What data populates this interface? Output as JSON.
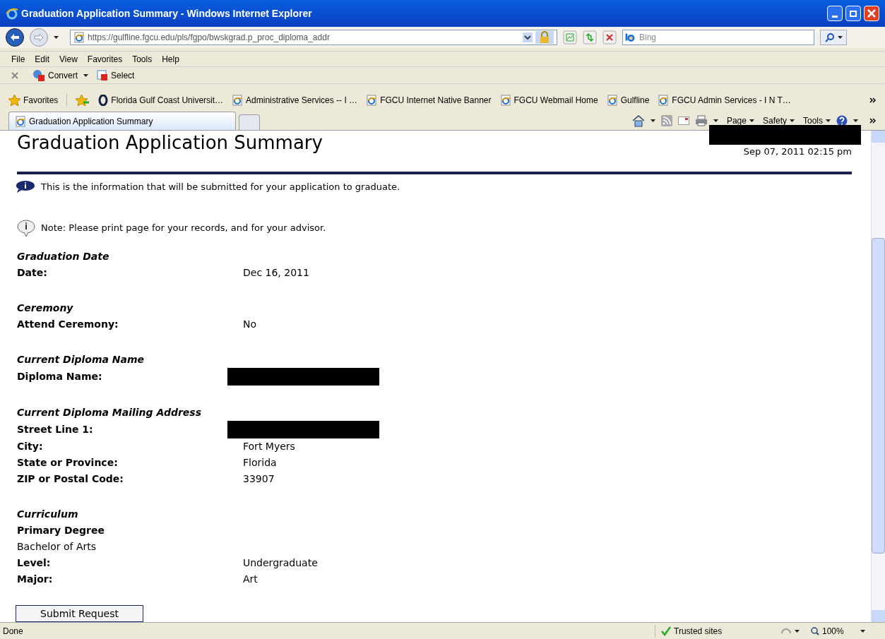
{
  "window": {
    "title": "Graduation Application Summary - Windows Internet Explorer"
  },
  "address": {
    "url": "https://gulfline.fgcu.edu/pls/fgpo/bwskgrad.p_proc_diploma_addr"
  },
  "search": {
    "placeholder": "Bing"
  },
  "menu": [
    "File",
    "Edit",
    "View",
    "Favorites",
    "Tools",
    "Help"
  ],
  "command_bar": [
    "Convert",
    "Select"
  ],
  "favorites": {
    "label": "Favorites",
    "links": [
      {
        "label": "Florida Gulf Coast Universit…",
        "kind": "site"
      },
      {
        "label": "Administrative Services -- I …",
        "kind": "ie"
      },
      {
        "label": "FGCU Internet Native Banner",
        "kind": "ie"
      },
      {
        "label": "FGCU Webmail Home",
        "kind": "ie"
      },
      {
        "label": "Gulfline",
        "kind": "ie"
      },
      {
        "label": "FGCU Admin Services - I N T…",
        "kind": "ie"
      }
    ]
  },
  "tabs": [
    {
      "label": "Graduation Application Summary",
      "selected": true
    }
  ],
  "page_tools": [
    "Page",
    "Safety",
    "Tools"
  ],
  "page": {
    "title": "Graduation Application Summary",
    "timestamp": "Sep 07, 2011 02:15 pm",
    "info": "This is the information that will be submitted for your application to graduate.",
    "note": "Note: Please print page for your records, and for your advisor.",
    "sections": [
      {
        "heading": "Graduation Date",
        "rows": [
          {
            "kind": "pair",
            "label": "Date:",
            "value": "Dec 16, 2011"
          }
        ]
      },
      {
        "heading": "Ceremony",
        "rows": [
          {
            "kind": "pair",
            "label": "Attend Ceremony:",
            "value": "No"
          }
        ]
      },
      {
        "heading": "Current Diploma Name",
        "rows": [
          {
            "kind": "redacted",
            "label": "Diploma Name:"
          }
        ]
      },
      {
        "heading": "Current Diploma Mailing Address",
        "rows": [
          {
            "kind": "redacted",
            "label": "Street Line 1:"
          },
          {
            "kind": "pair",
            "label": "City:",
            "value": "Fort Myers"
          },
          {
            "kind": "pair",
            "label": "State or Province:",
            "value": "Florida"
          },
          {
            "kind": "pair",
            "label": "ZIP or Postal Code:",
            "value": "33907"
          }
        ]
      },
      {
        "heading": "Curriculum",
        "rows": [
          {
            "kind": "stacked",
            "label": "Primary Degree",
            "value": "Bachelor of Arts"
          },
          {
            "kind": "pair",
            "label": "Level:",
            "value": "Undergraduate"
          },
          {
            "kind": "pair",
            "label": "Major:",
            "value": "Art"
          }
        ]
      }
    ],
    "submit": "Submit Request"
  },
  "status_bar": {
    "text": "Done",
    "zone": "Trusted sites",
    "zoom": "100%"
  }
}
